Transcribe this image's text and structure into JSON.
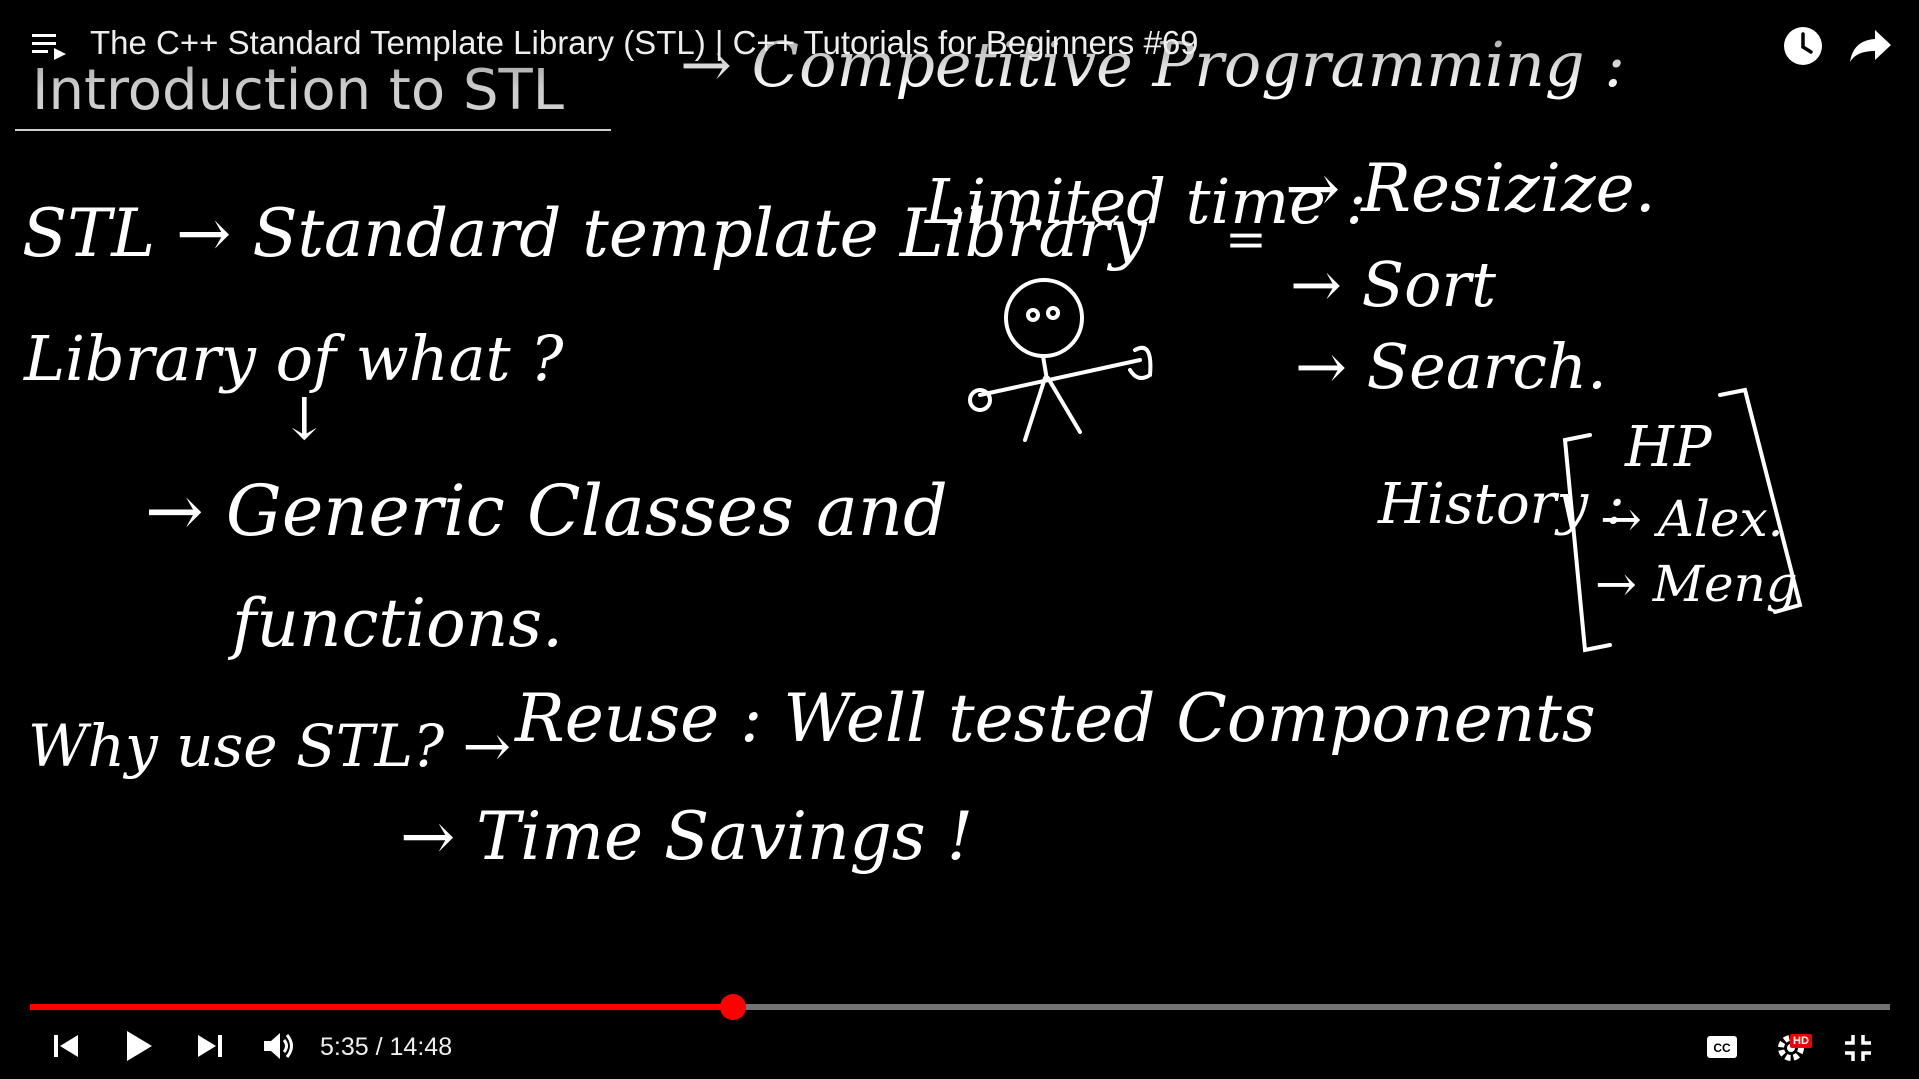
{
  "player": {
    "title": "The C++ Standard Template Library (STL) | C++ Tutorials for Beginners #69",
    "time_current": "5:35",
    "time_separator": "/",
    "time_total": "14:48",
    "progress_fraction": 0.378,
    "hd_badge": "HD",
    "accent_color": "#ff0000"
  },
  "slide": {
    "heading": "Introduction to STL",
    "top_note": "→ Competitive Programming :",
    "lines": {
      "stl": "STL → Standard template Library",
      "library_of_what": "Library of what ?",
      "down_arrow": "↓",
      "generic": "→ Generic Classes and",
      "functions": "functions.",
      "why": "Why use STL? →",
      "reuse": "Reuse : Well tested Components",
      "time_savings": "→ Time Savings !",
      "limited_time": "Limited time :",
      "equals": "=",
      "resizize": "→ Resizize.",
      "sort": "→ Sort",
      "search": "→ Search.",
      "history": "History :",
      "hp": "HP",
      "alex": "→ Alex.",
      "meng": "→ Meng"
    }
  },
  "icons": {
    "playlist": "playlist-icon",
    "watch_later": "clock-icon",
    "share": "share-arrow-icon",
    "prev": "skip-previous-icon",
    "play": "play-icon",
    "next": "skip-next-icon",
    "volume": "volume-icon",
    "cc": "closed-captions-icon",
    "settings": "settings-gear-icon",
    "exit_fullscreen": "exit-fullscreen-icon"
  }
}
